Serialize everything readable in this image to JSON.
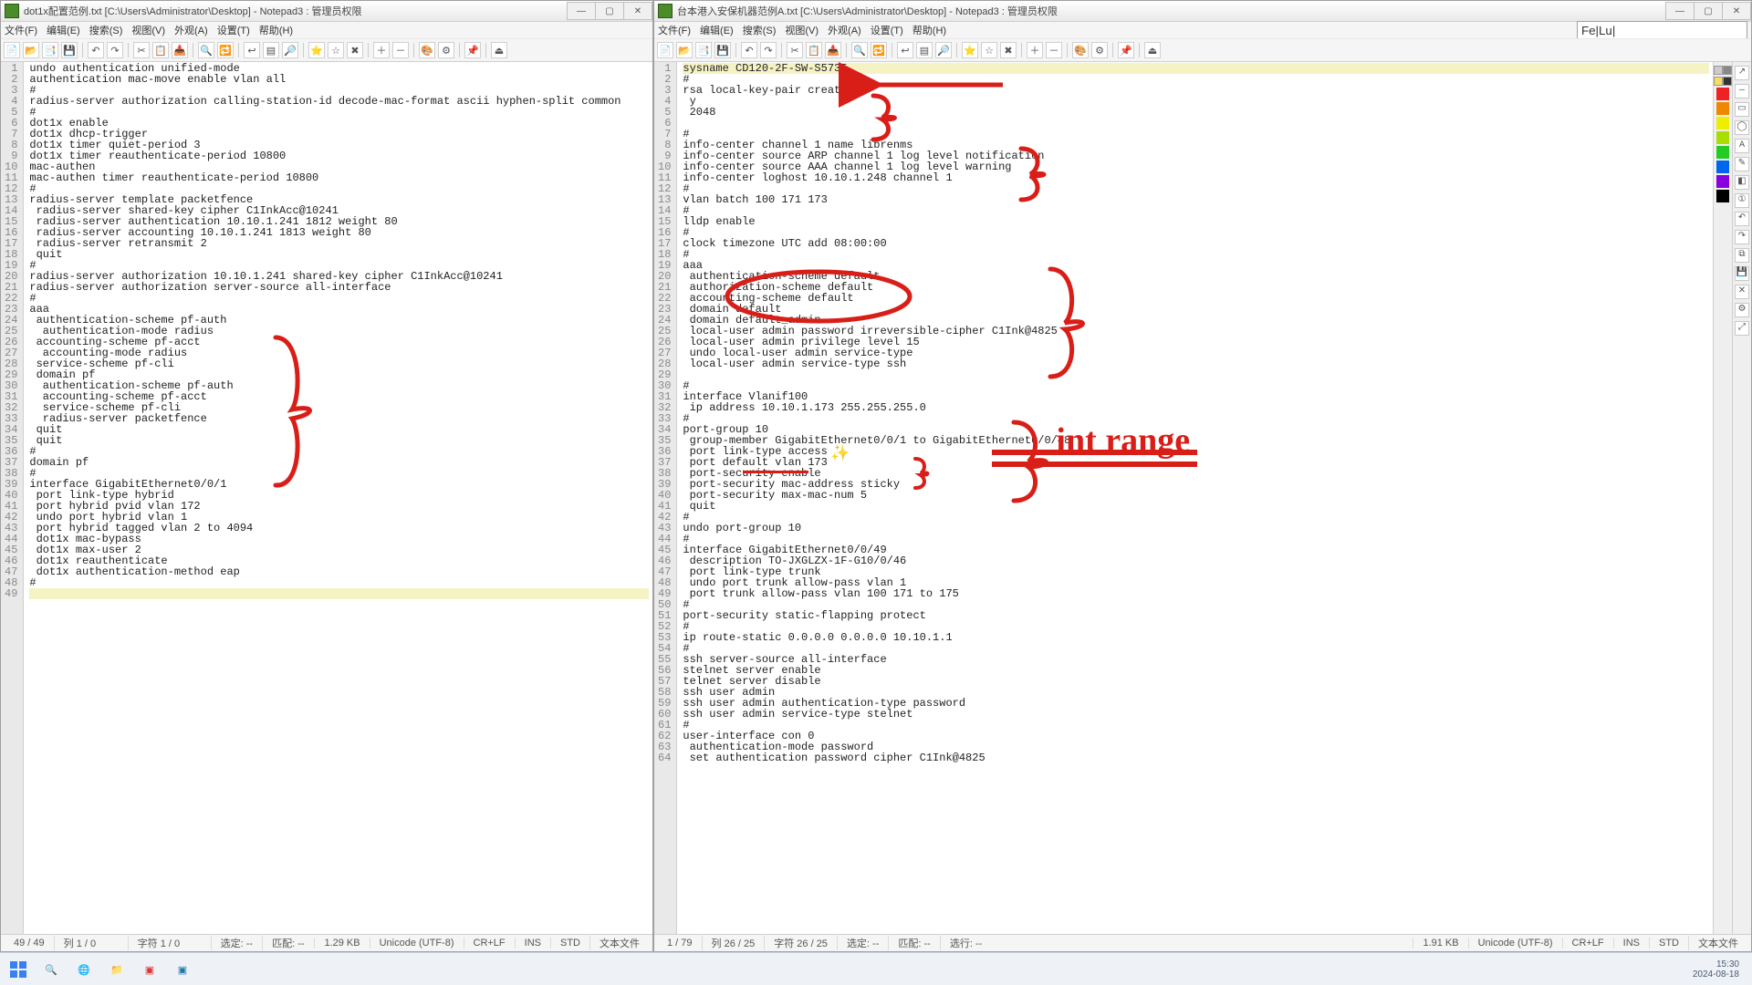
{
  "left": {
    "title": "dot1x配置范例.txt [C:\\Users\\Administrator\\Desktop] - Notepad3 : 管理员权限",
    "menu": [
      "文件(F)",
      "编辑(E)",
      "搜索(S)",
      "视图(V)",
      "外观(A)",
      "设置(T)",
      "帮助(H)"
    ],
    "status": {
      "pos": "49 / 49",
      "col": "列 1 / 0",
      "sel": "字符 1 / 0",
      "sel2": "选定: --",
      "match": "匹配: --",
      "size": "1.29 KB",
      "enc": "Unicode (UTF-8)",
      "eol": "CR+LF",
      "ins": "INS",
      "std": "STD",
      "type": "文本文件"
    },
    "code": [
      "undo authentication unified-mode",
      "authentication mac-move enable vlan all",
      "#",
      "radius-server authorization calling-station-id decode-mac-format ascii hyphen-split common",
      "#",
      "dot1x enable",
      "dot1x dhcp-trigger",
      "dot1x timer quiet-period 3",
      "dot1x timer reauthenticate-period 10800",
      "mac-authen",
      "mac-authen timer reauthenticate-period 10800",
      "#",
      "radius-server template packetfence",
      " radius-server shared-key cipher C1InkAcc@10241",
      " radius-server authentication 10.10.1.241 1812 weight 80",
      " radius-server accounting 10.10.1.241 1813 weight 80",
      " radius-server retransmit 2",
      " quit",
      "#",
      "radius-server authorization 10.10.1.241 shared-key cipher C1InkAcc@10241",
      "radius-server authorization server-source all-interface",
      "#",
      "aaa",
      " authentication-scheme pf-auth",
      "  authentication-mode radius",
      " accounting-scheme pf-acct",
      "  accounting-mode radius",
      " service-scheme pf-cli",
      " domain pf",
      "  authentication-scheme pf-auth",
      "  accounting-scheme pf-acct",
      "  service-scheme pf-cli",
      "  radius-server packetfence",
      " quit",
      " quit",
      "#",
      "domain pf",
      "#",
      "interface GigabitEthernet0/0/1",
      " port link-type hybrid",
      " port hybrid pvid vlan 172",
      " undo port hybrid vlan 1",
      " port hybrid tagged vlan 2 to 4094",
      " dot1x mac-bypass",
      " dot1x max-user 2",
      " dot1x reauthenticate",
      " dot1x authentication-method eap",
      "#",
      ""
    ]
  },
  "right": {
    "title": "台本港入安保机器范例A.txt [C:\\Users\\Administrator\\Desktop] - Notepad3 : 管理员权限",
    "menu": [
      "文件(F)",
      "编辑(E)",
      "搜索(S)",
      "视图(V)",
      "外观(A)",
      "设置(T)",
      "帮助(H)"
    ],
    "searchbox_value": "Fe|Lu|",
    "status": {
      "pos": "1 / 79",
      "col": "列 26 / 25",
      "sel": "字符 26 / 25",
      "sel2": "选定: --",
      "match": "匹配: --",
      "wrap": "选行: --",
      "size": "1.91 KB",
      "enc": "Unicode (UTF-8)",
      "eol": "CR+LF",
      "ins": "INS",
      "std": "STD",
      "type": "文本文件"
    },
    "code": [
      "sysname CD120-2F-SW-S5735",
      "#",
      "rsa local-key-pair create",
      " y",
      " 2048",
      "",
      "#",
      "info-center channel 1 name librenms",
      "info-center source ARP channel 1 log level notification",
      "info-center source AAA channel 1 log level warning",
      "info-center loghost 10.10.1.248 channel 1",
      "#",
      "vlan batch 100 171 173",
      "#",
      "lldp enable",
      "#",
      "clock timezone UTC add 08:00:00",
      "#",
      "aaa",
      " authentication-scheme default",
      " authorization-scheme default",
      " accounting-scheme default",
      " domain default",
      " domain default_admin",
      " local-user admin password irreversible-cipher C1Ink@4825",
      " local-user admin privilege level 15",
      " undo local-user admin service-type",
      " local-user admin service-type ssh",
      "",
      "#",
      "interface Vlanif100",
      " ip address 10.10.1.173 255.255.255.0",
      "#",
      "port-group 10",
      " group-member GigabitEthernet0/0/1 to GigabitEthernet0/0/48",
      " port link-type access",
      " port default vlan 173",
      " port-security enable",
      " port-security mac-address sticky",
      " port-security max-mac-num 5",
      " quit",
      "#",
      "undo port-group 10",
      "#",
      "interface GigabitEthernet0/0/49",
      " description TO-JXGLZX-1F-G10/0/46",
      " port link-type trunk",
      " undo port trunk allow-pass vlan 1",
      " port trunk allow-pass vlan 100 171 to 175",
      "#",
      "port-security static-flapping protect",
      "#",
      "ip route-static 0.0.0.0 0.0.0.0 10.10.1.1",
      "#",
      "ssh server-source all-interface",
      "stelnet server enable",
      "telnet server disable",
      "ssh user admin",
      "ssh user admin authentication-type password",
      "ssh user admin service-type stelnet",
      "#",
      "user-interface con 0",
      " authentication-mode password",
      " set authentication password cipher C1Ink@4825"
    ]
  },
  "annotations_text": {
    "intrange": "int range"
  },
  "taskbar": {
    "time": "15:30",
    "date": "2024-08-18"
  },
  "colors": {
    "red": "#d91e18",
    "hl": "#f3efb4"
  }
}
